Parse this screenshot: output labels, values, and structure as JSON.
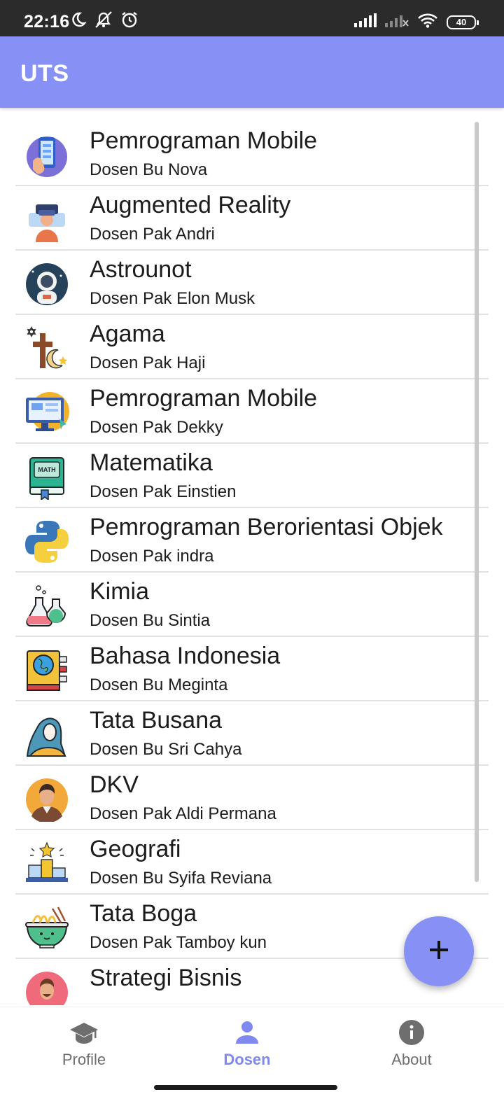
{
  "status_bar": {
    "time": "22:16",
    "battery": "40",
    "left_icons": [
      "moon-icon",
      "notifications-off-icon",
      "alarm-icon"
    ],
    "right_icons": [
      "signal-icon",
      "signal-off-icon",
      "wifi-icon",
      "battery-icon"
    ]
  },
  "app_bar": {
    "title": "UTS",
    "color": "#8790f5"
  },
  "list": {
    "items": [
      {
        "title": "Pemrograman Mobile",
        "subtitle": "Dosen Bu Nova",
        "icon": "phone-hand-icon"
      },
      {
        "title": "Augmented Reality",
        "subtitle": "Dosen Pak Andri",
        "icon": "vr-headset-icon"
      },
      {
        "title": "Astrounot",
        "subtitle": "Dosen Pak Elon Musk",
        "icon": "astronaut-icon"
      },
      {
        "title": "Agama",
        "subtitle": "Dosen Pak Haji",
        "icon": "religion-icon"
      },
      {
        "title": "Pemrograman Mobile",
        "subtitle": "Dosen Pak Dekky",
        "icon": "monitor-icon"
      },
      {
        "title": "Matematika",
        "subtitle": "Dosen Pak Einstien",
        "icon": "math-book-icon"
      },
      {
        "title": "Pemrograman Berorientasi Objek",
        "subtitle": "Dosen Pak indra",
        "icon": "python-icon"
      },
      {
        "title": "Kimia",
        "subtitle": "Dosen Bu Sintia",
        "icon": "chemistry-flask-icon"
      },
      {
        "title": "Bahasa Indonesia",
        "subtitle": "Dosen Bu Meginta",
        "icon": "globe-book-icon"
      },
      {
        "title": "Tata Busana",
        "subtitle": "Dosen Bu Sri Cahya",
        "icon": "hijab-woman-icon"
      },
      {
        "title": "DKV",
        "subtitle": "Dosen Pak Aldi Permana",
        "icon": "man-avatar-icon"
      },
      {
        "title": "Geografi",
        "subtitle": "Dosen Bu Syifa Reviana",
        "icon": "podium-star-icon"
      },
      {
        "title": "Tata Boga",
        "subtitle": "Dosen Pak Tamboy kun",
        "icon": "noodle-bowl-icon"
      },
      {
        "title": "Strategi Bisnis",
        "subtitle": "",
        "icon": "businessman-icon"
      }
    ]
  },
  "fab": {
    "label": "+",
    "icon": "add-icon"
  },
  "bottom_nav": {
    "items": [
      {
        "label": "Profile",
        "icon": "graduation-cap-icon",
        "active": false
      },
      {
        "label": "Dosen",
        "icon": "person-icon",
        "active": true
      },
      {
        "label": "About",
        "icon": "info-icon",
        "active": false
      }
    ]
  }
}
